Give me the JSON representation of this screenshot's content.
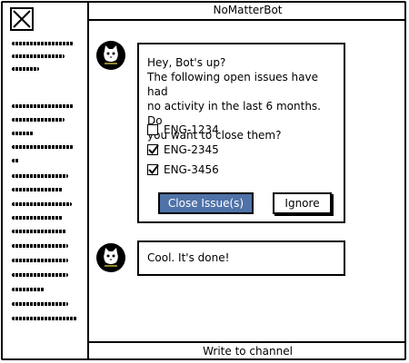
{
  "header": {
    "title": "NoMatterBot"
  },
  "composer": {
    "placeholder_label": "Write to channel"
  },
  "messages": [
    {
      "lines": [
        "Hey, Bot's up?",
        "The following open issues have had",
        "no activity in the last 6 months. Do",
        "you want to close them?"
      ],
      "issues": [
        {
          "label": "ENG-1234",
          "checked": false
        },
        {
          "label": "ENG-2345",
          "checked": true
        },
        {
          "label": "ENG-3456",
          "checked": true
        }
      ],
      "primary_button": "Close Issue(s)",
      "secondary_button": "Ignore"
    },
    {
      "text": "Cool. It's done!"
    }
  ],
  "colors": {
    "primary_button": "#4f72a8"
  }
}
